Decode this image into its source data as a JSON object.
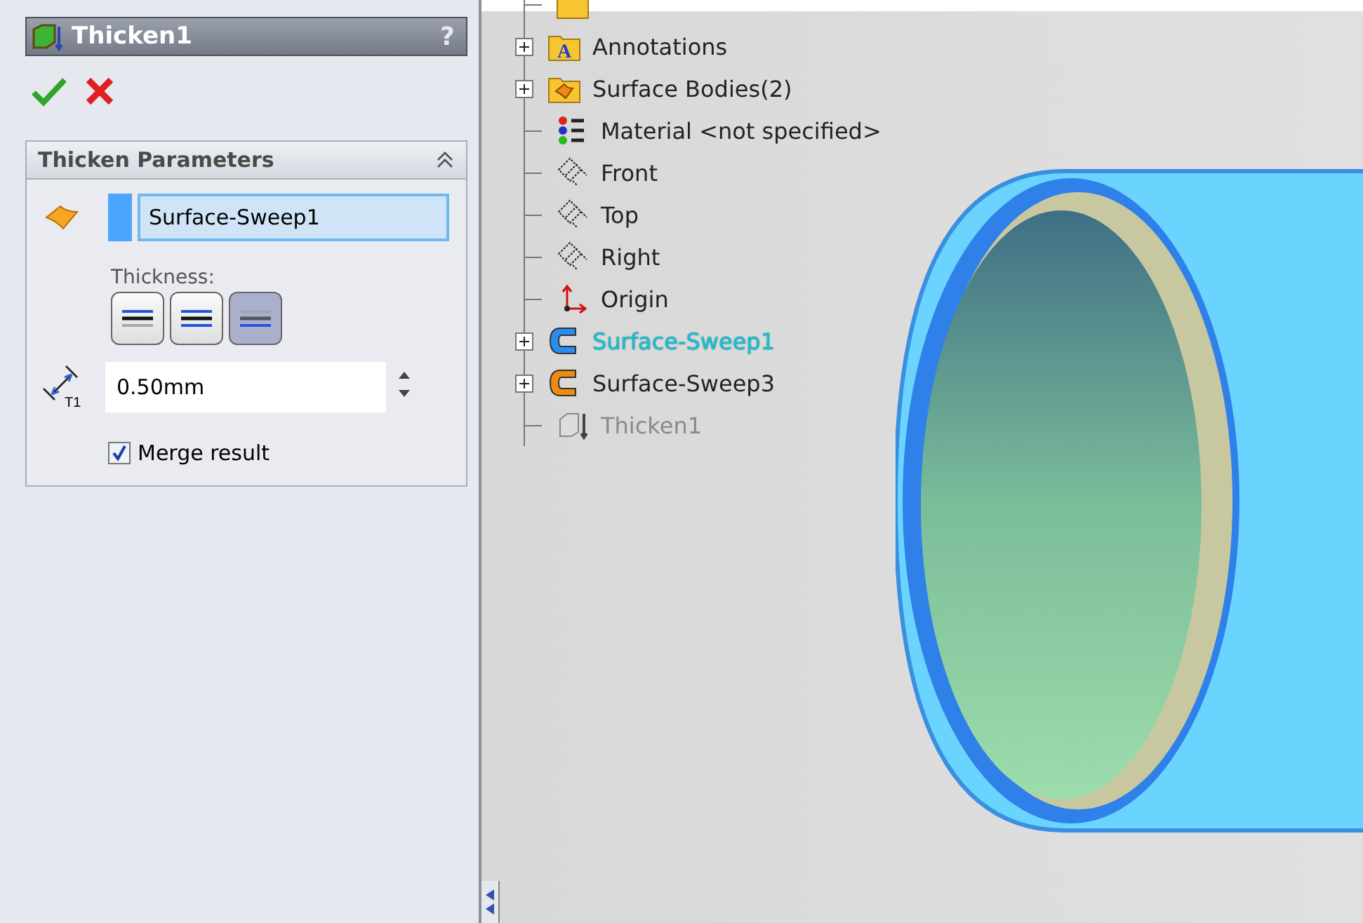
{
  "panel": {
    "title": "Thicken1",
    "help": "?"
  },
  "group": {
    "title": "Thicken Parameters",
    "face": "Surface-Sweep1",
    "thickness_label": "Thickness:",
    "sides": [
      {
        "selected": false
      },
      {
        "selected": false
      },
      {
        "selected": true
      }
    ],
    "thickness": "0.50mm",
    "dimension_label": "T1",
    "merge": {
      "label": "Merge result",
      "checked": true
    }
  },
  "tree": [
    {
      "label": "Annotations",
      "kind": "annotations",
      "icon_letter": "A",
      "expandable": true,
      "selected": false,
      "disabled": false
    },
    {
      "label": "Surface Bodies(2)",
      "kind": "bodies",
      "expandable": true,
      "selected": false,
      "disabled": false
    },
    {
      "label": "Material <not specified>",
      "kind": "material",
      "expandable": false,
      "selected": false,
      "disabled": false
    },
    {
      "label": "Front",
      "kind": "plane",
      "expandable": false,
      "selected": false,
      "disabled": false
    },
    {
      "label": "Top",
      "kind": "plane",
      "expandable": false,
      "selected": false,
      "disabled": false
    },
    {
      "label": "Right",
      "kind": "plane",
      "expandable": false,
      "selected": false,
      "disabled": false
    },
    {
      "label": "Origin",
      "kind": "origin",
      "expandable": false,
      "selected": false,
      "disabled": false
    },
    {
      "label": "Surface-Sweep1",
      "kind": "sweep-blue",
      "expandable": true,
      "selected": true,
      "disabled": false
    },
    {
      "label": "Surface-Sweep3",
      "kind": "sweep-orange",
      "expandable": true,
      "selected": false,
      "disabled": false
    },
    {
      "label": "Thicken1",
      "kind": "thicken",
      "expandable": false,
      "selected": false,
      "disabled": true
    }
  ]
}
